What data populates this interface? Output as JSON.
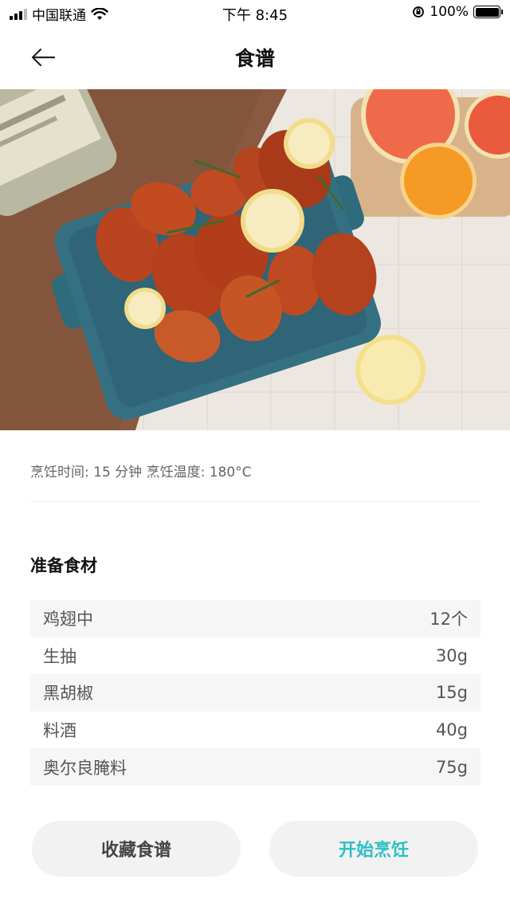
{
  "status_bar": {
    "carrier": "中国联通",
    "time": "下午 8:45",
    "battery": "100%"
  },
  "nav": {
    "title": "食谱",
    "back_icon": "arrow-left-icon"
  },
  "hero": {
    "description_icon": "food-photo"
  },
  "meta": {
    "text": "烹饪时间: 15 分钟 烹饪温度: 180°C"
  },
  "ingredients": {
    "title": "准备食材",
    "items": [
      {
        "name": "鸡翅中",
        "amount": "12个"
      },
      {
        "name": "生抽",
        "amount": "30g"
      },
      {
        "name": "黑胡椒",
        "amount": "15g"
      },
      {
        "name": "料酒",
        "amount": "40g"
      },
      {
        "name": "奥尔良腌料",
        "amount": "75g"
      }
    ]
  },
  "buttons": {
    "favorite": "收藏食谱",
    "start": "开始烹饪"
  },
  "colors": {
    "accent": "#2ebfc6",
    "row_alt": "#f6f6f6",
    "button_bg": "#f2f2f2"
  }
}
